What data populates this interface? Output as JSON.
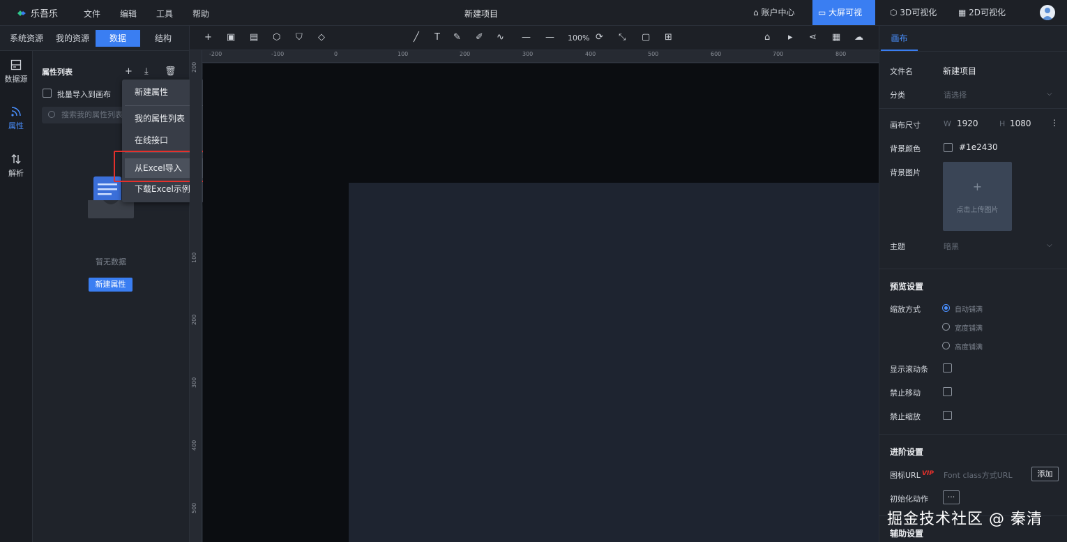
{
  "app": {
    "name": "乐吾乐",
    "project_title": "新建项目"
  },
  "menu": [
    "文件",
    "编辑",
    "工具",
    "帮助"
  ],
  "topnav": {
    "account": "账户中心",
    "bigscreen": "大屏可视化",
    "v3d": "3D可视化",
    "v2d": "2D可视化"
  },
  "left_tabs": [
    "系统资源",
    "我的资源",
    "数据",
    "结构"
  ],
  "rail": [
    {
      "label": "数据源",
      "icon": "database-icon"
    },
    {
      "label": "属性",
      "icon": "rss-icon"
    },
    {
      "label": "解析",
      "icon": "swap-icon"
    }
  ],
  "panel": {
    "title": "属性列表",
    "batch_import": "批量导入到画布",
    "search_placeholder": "搜索我的属性列表",
    "empty_text": "暂无数据",
    "new_button": "新建属性"
  },
  "dropdown": {
    "items": [
      {
        "label": "新建属性"
      },
      {
        "label": "我的属性列表",
        "submenu": true
      },
      {
        "label": "在线接口",
        "submenu": true
      },
      {
        "label": "从Excel导入",
        "highlighted": true
      },
      {
        "label": "下载Excel示例"
      }
    ]
  },
  "toolbar": {
    "zoom": "100%"
  },
  "ruler": {
    "h_labels": [
      "-200",
      "-100",
      "0",
      "100",
      "200",
      "300",
      "400",
      "500",
      "600",
      "700",
      "800"
    ],
    "v_labels": [
      "200",
      "100",
      "200",
      "300",
      "400",
      "500"
    ]
  },
  "right": {
    "tab": "画布",
    "filename_label": "文件名",
    "filename": "新建项目",
    "category_label": "分类",
    "category_placeholder": "请选择",
    "size_label": "画布尺寸",
    "w_label": "W",
    "w": "1920",
    "h_label": "H",
    "h": "1080",
    "bgcolor_label": "背景颜色",
    "bgcolor": "#1e2430",
    "bgimage_label": "背景图片",
    "upload_text": "点击上传图片",
    "theme_label": "主题",
    "theme_placeholder": "暗黑",
    "preview_title": "预览设置",
    "scale_label": "缩放方式",
    "scale_options": [
      "自动铺满",
      "宽度铺满",
      "高度铺满"
    ],
    "scrollbar_label": "显示滚动条",
    "no_move_label": "禁止移动",
    "no_zoom_label": "禁止缩放",
    "advanced_title": "进阶设置",
    "icon_url_label": "图标URL",
    "vip": "VIP",
    "icon_url_placeholder": "Font class方式URL",
    "add_button": "添加",
    "init_action_label": "初始化动作",
    "init_action_btn": "···",
    "assist_title": "辅助设置"
  },
  "watermark": "掘金技术社区 @ 秦清",
  "colors": {
    "accent": "#3a7ef2",
    "highlight": "#e4302b"
  }
}
